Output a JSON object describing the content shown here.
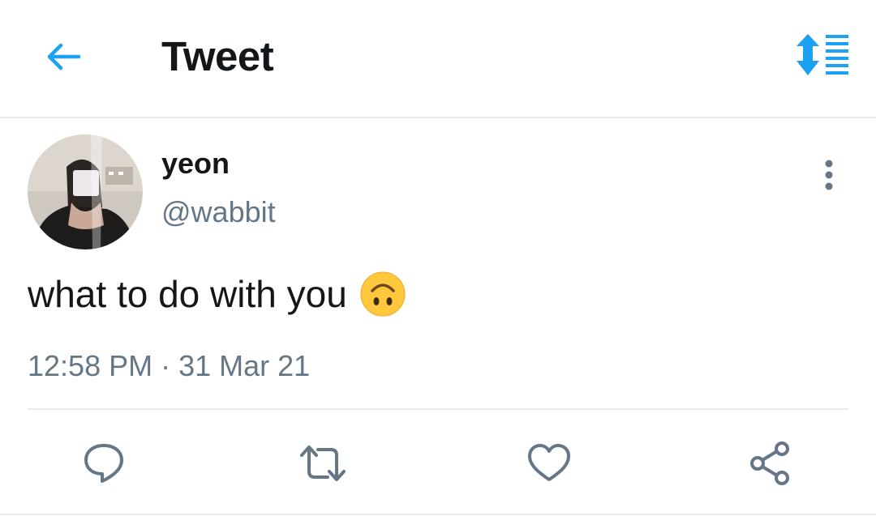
{
  "header": {
    "title": "Tweet",
    "back_icon": "arrow-left-icon",
    "sort_icon": "sort-list-icon",
    "accent_color": "#1da1f2"
  },
  "tweet": {
    "display_name": "yeon",
    "handle": "@wabbit",
    "text": "what to do with you",
    "emoji": "upside-down-face-emoji",
    "timestamp": "12:58 PM · 31 Mar 21",
    "more_icon": "more-vertical-icon"
  },
  "actions": [
    {
      "name": "reply",
      "icon": "reply-icon"
    },
    {
      "name": "retweet",
      "icon": "retweet-icon"
    },
    {
      "name": "like",
      "icon": "heart-icon"
    },
    {
      "name": "share",
      "icon": "share-icon"
    }
  ],
  "colors": {
    "text_primary": "#14171a",
    "text_secondary": "#657786",
    "divider": "#e6ecf0",
    "action_icon": "#657786"
  }
}
